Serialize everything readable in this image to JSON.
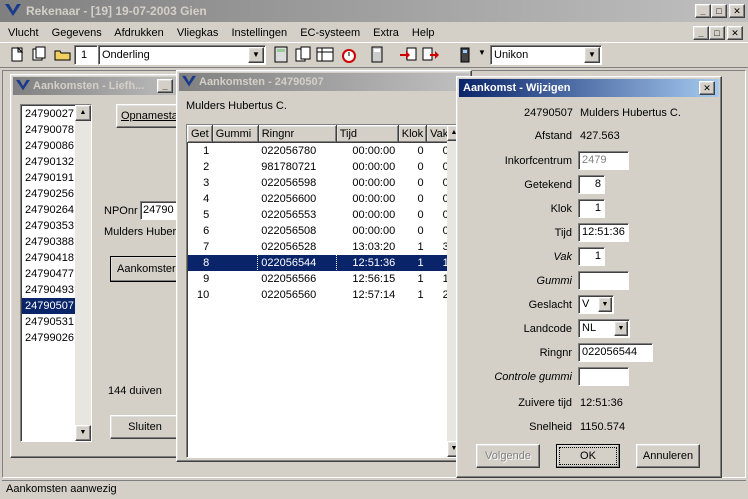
{
  "app": {
    "title": "Rekenaar - [19]  19-07-2003  Gien",
    "menu": [
      "Vlucht",
      "Gegevens",
      "Afdrukken",
      "Vliegkas",
      "Instellingen",
      "EC-systeem",
      "Extra",
      "Help"
    ],
    "toolbar": {
      "count": "1",
      "combo1": "Onderling",
      "combo2": "Unikon"
    },
    "status": "Aankomsten aanwezig"
  },
  "win1": {
    "title": "Aankomsten - Liefh...",
    "list": [
      "24790027",
      "24790078",
      "24790086",
      "24790132",
      "24790191",
      "24790256",
      "24790264",
      "24790353",
      "24790388",
      "24790418",
      "24790477",
      "24790493",
      "24790507",
      "24790531",
      "24799026"
    ],
    "selected": "24790507",
    "opname_button": "Opnamesta",
    "npo_label": "NPOnr",
    "npo_value": "24790",
    "owner": "Mulders Huber",
    "aankomsten_button": "Aankomster",
    "duiven": "144 duiven",
    "sluiten_button": "Sluiten"
  },
  "win2": {
    "title": "Aankomsten - 24790507",
    "owner": "Mulders Hubertus C.",
    "columns": [
      "Get",
      "Gummi",
      "Ringnr",
      "Tijd",
      "Klok",
      "Vak"
    ],
    "rows": [
      [
        "1",
        "",
        "022056780",
        "00:00:00",
        "0",
        "0"
      ],
      [
        "2",
        "",
        "981780721",
        "00:00:00",
        "0",
        "0"
      ],
      [
        "3",
        "",
        "022056598",
        "00:00:00",
        "0",
        "0"
      ],
      [
        "4",
        "",
        "022056600",
        "00:00:00",
        "0",
        "0"
      ],
      [
        "5",
        "",
        "022056553",
        "00:00:00",
        "0",
        "0"
      ],
      [
        "6",
        "",
        "022056508",
        "00:00:00",
        "0",
        "0"
      ],
      [
        "7",
        "",
        "022056528",
        "13:03:20",
        "1",
        "3"
      ],
      [
        "8",
        "",
        "022056544",
        "12:51:36",
        "1",
        "1"
      ],
      [
        "9",
        "",
        "022056566",
        "12:56:15",
        "1",
        "1"
      ],
      [
        "10",
        "",
        "022056560",
        "12:57:14",
        "1",
        "2"
      ]
    ],
    "selected_row": "8"
  },
  "dialog": {
    "title": "Aankomst - Wijzigen",
    "header_nr": "24790507",
    "header_name": "Mulders Hubertus C.",
    "afstand_label": "Afstand",
    "afstand_value": "427.563",
    "inkorf_label": "Inkorfcentrum",
    "inkorf_value": "2479",
    "getekend_label": "Getekend",
    "getekend_value": "8",
    "klok_label": "Klok",
    "klok_value": "1",
    "tijd_label": "Tijd",
    "tijd_value": "12:51:36",
    "vak_label": "Vak",
    "vak_value": "1",
    "gummi_label": "Gummi",
    "gummi_value": "",
    "geslacht_label": "Geslacht",
    "geslacht_value": "V",
    "landcode_label": "Landcode",
    "landcode_value": "NL",
    "ringnr_label": "Ringnr",
    "ringnr_value": "022056544",
    "controle_label": "Controle gummi",
    "controle_value": "",
    "zuivere_label": "Zuivere tijd",
    "zuivere_value": "12:51:36",
    "snelheid_label": "Snelheid",
    "snelheid_value": "1150.574",
    "volgende_button": "Volgende",
    "ok_button": "OK",
    "annuleren_button": "Annuleren"
  }
}
